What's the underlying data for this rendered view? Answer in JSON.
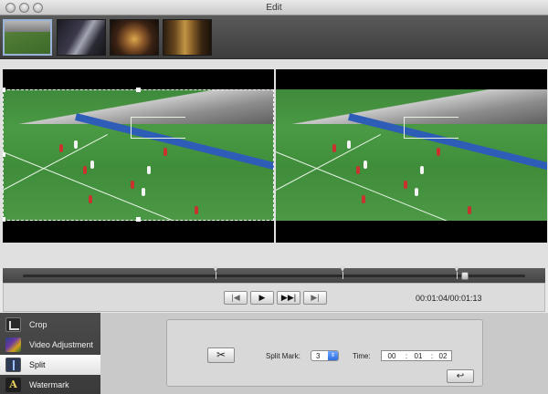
{
  "window": {
    "title": "Edit"
  },
  "thumbnails": [
    {
      "name": "soccer-match"
    },
    {
      "name": "concert-stage"
    },
    {
      "name": "performer-closeup"
    },
    {
      "name": "curtain-scene"
    }
  ],
  "transport": {
    "prev_glyph": "|◀",
    "play_glyph": "▶",
    "next_glyph": "▶▶|",
    "end_glyph": "▶|",
    "timecode": "00:01:04/00:01:13"
  },
  "timeline": {
    "playhead_fraction": 0.88,
    "split_marks_fraction": [
      0.385,
      0.637,
      0.864
    ]
  },
  "sidebar": {
    "items": [
      {
        "label": "Crop",
        "icon": "crop-icon"
      },
      {
        "label": "Video Adjustment",
        "icon": "video-adjustment-icon"
      },
      {
        "label": "Split",
        "icon": "split-icon"
      },
      {
        "label": "Watermark",
        "icon": "watermark-icon"
      }
    ],
    "watermark_glyph": "A"
  },
  "split": {
    "scissor_glyph": "✂",
    "split_mark_label": "Split Mark:",
    "split_mark_value": "3",
    "spin_glyph": "⇕",
    "time_label": "Time:",
    "time_hh": "00",
    "time_mm": "01",
    "time_ss": "02",
    "time_sep": ":",
    "undo_glyph": "↩"
  }
}
